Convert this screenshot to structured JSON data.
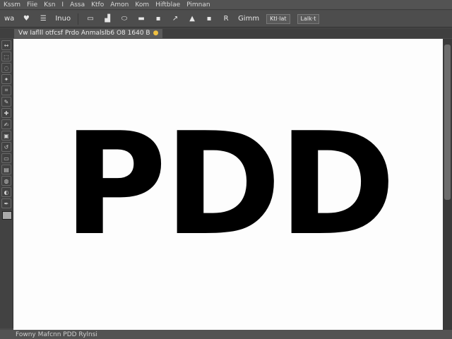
{
  "menu": [
    "Kssm",
    "Fiie",
    "Ksn",
    "I",
    "Assa",
    "Ktfo",
    "Amon",
    "Kom",
    "Hiftblae",
    "Pimnan"
  ],
  "options": {
    "items": [
      "wa",
      "Inuo",
      "Gimm"
    ],
    "button1": "Ktl·lat",
    "button2": "Lalk·t"
  },
  "tab": {
    "label": "Vw Iaflll otfcsf Prdo Anmalslb6 O8 1640 B"
  },
  "canvas_text": "PDD",
  "status": "Fowny  Mafcnn PDD Rylnsi"
}
